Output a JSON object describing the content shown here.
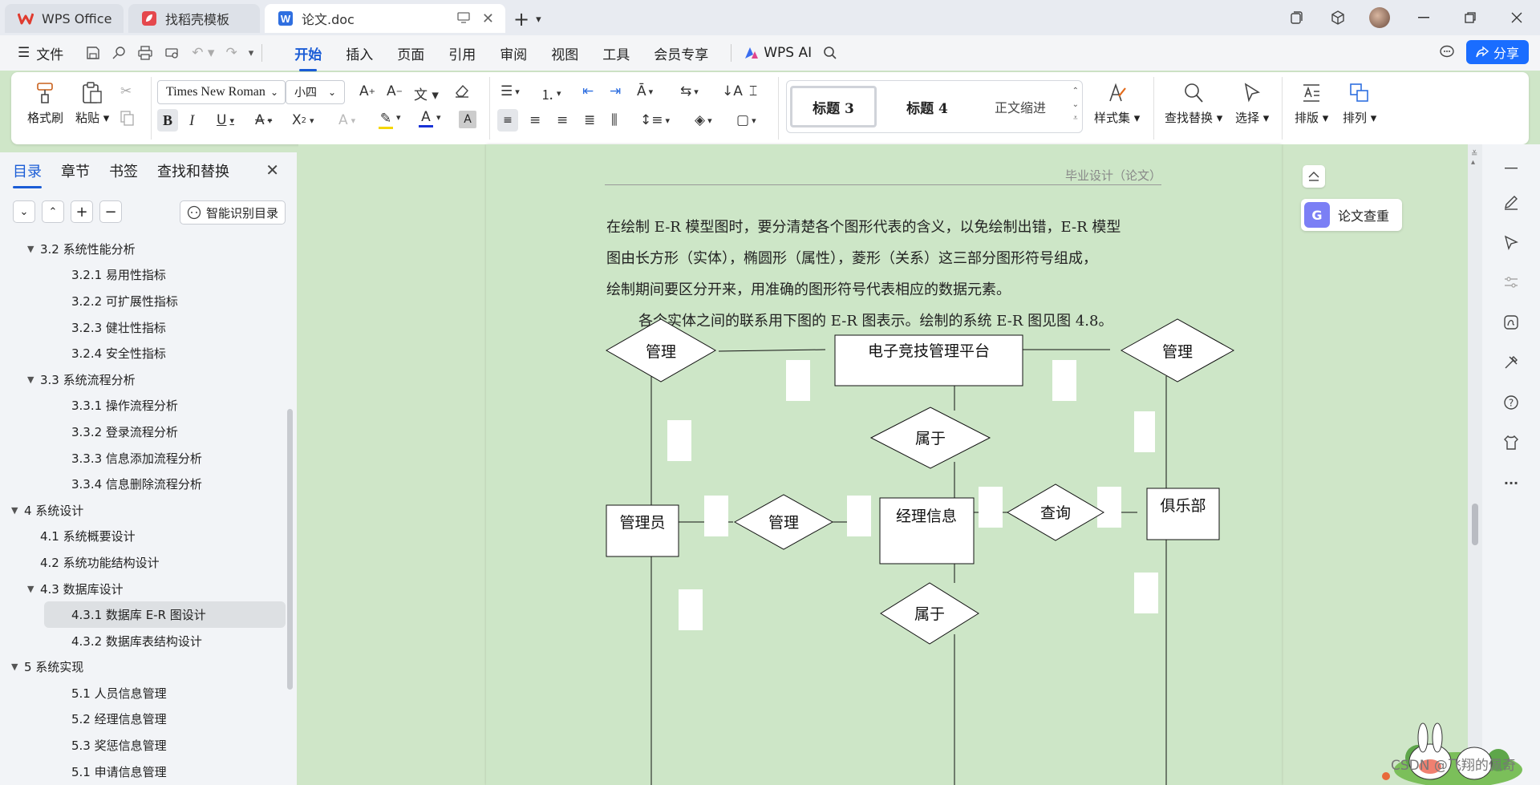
{
  "tabs": [
    {
      "label": "WPS Office",
      "icon": "wps-logo-icon"
    },
    {
      "label": "找稻壳模板",
      "icon": "docer-icon"
    },
    {
      "label": "论文.doc",
      "icon": "word-doc-icon"
    }
  ],
  "menubar": {
    "file_label": "文件",
    "tabs": [
      "开始",
      "插入",
      "页面",
      "引用",
      "审阅",
      "视图",
      "工具",
      "会员专享"
    ],
    "active_tab": "开始",
    "wps_ai": "WPS AI",
    "share": "分享"
  },
  "ribbon": {
    "format_painter": "格式刷",
    "paste": "粘贴",
    "font_name": "Times New Roman",
    "font_size": "小四",
    "styles": [
      "标题 3",
      "标题 4",
      "正文缩进"
    ],
    "style_set": "样式集",
    "find_replace": "查找替换",
    "select": "选择",
    "layout": "排版",
    "arrange": "排列"
  },
  "leftpanel": {
    "tabs": [
      "目录",
      "章节",
      "书签",
      "查找和替换"
    ],
    "auto_toc": "智能识别目录",
    "toc": [
      {
        "text": "3.2  系统性能分析",
        "level": 2,
        "expanded": true
      },
      {
        "text": "3.2.1  易用性指标",
        "level": 3
      },
      {
        "text": "3.2.2  可扩展性指标",
        "level": 3
      },
      {
        "text": "3.2.3  健壮性指标",
        "level": 3
      },
      {
        "text": "3.2.4  安全性指标",
        "level": 3
      },
      {
        "text": "3.3  系统流程分析",
        "level": 2,
        "expanded": true
      },
      {
        "text": "3.3.1  操作流程分析",
        "level": 3
      },
      {
        "text": "3.3.2  登录流程分析",
        "level": 3
      },
      {
        "text": "3.3.3  信息添加流程分析",
        "level": 3
      },
      {
        "text": "3.3.4  信息删除流程分析",
        "level": 3
      },
      {
        "text": "4  系统设计",
        "level": 1,
        "expanded": true
      },
      {
        "text": "4.1  系统概要设计",
        "level": 2
      },
      {
        "text": "4.2  系统功能结构设计",
        "level": 2
      },
      {
        "text": "4.3  数据库设计",
        "level": 2,
        "expanded": true
      },
      {
        "text": "4.3.1  数据库 E-R 图设计",
        "level": 3,
        "selected": true
      },
      {
        "text": "4.3.2  数据库表结构设计",
        "level": 3
      },
      {
        "text": "5  系统实现",
        "level": 1,
        "expanded": true
      },
      {
        "text": "5.1 人员信息管理",
        "level": 3
      },
      {
        "text": "5.2  经理信息管理",
        "level": 3
      },
      {
        "text": "5.3 奖惩信息管理",
        "level": 3
      },
      {
        "text": "5.1 申请信息管理",
        "level": 3
      }
    ]
  },
  "document": {
    "header": "毕业设计（论文）",
    "paragraphs": [
      "在绘制 E-R 模型图时，要分清楚各个图形代表的含义，以免绘制出错，E-R 模型",
      "图由长方形（实体），椭圆形（属性），菱形（关系）这三部分图形符号组成，",
      "绘制期间要区分开来，用准确的图形符号代表相应的数据元素。",
      "各个实体之间的联系用下图的 E-R 图表示。绘制的系统 E-R 图见图 4.8。"
    ],
    "er": {
      "entities": [
        "电子竞技管理平台",
        "管理员",
        "经理信息",
        "俱乐部"
      ],
      "relations": [
        "管理",
        "管理",
        "属于",
        "管理",
        "查询",
        "属于"
      ]
    }
  },
  "floating": {
    "paper_check": "论文查重"
  },
  "watermark": "CSDN @飞翔的佩奇",
  "colors": {
    "accent": "#1a5cd6",
    "page_bg": "#cde6c8",
    "share_bg": "#1a6dff"
  }
}
